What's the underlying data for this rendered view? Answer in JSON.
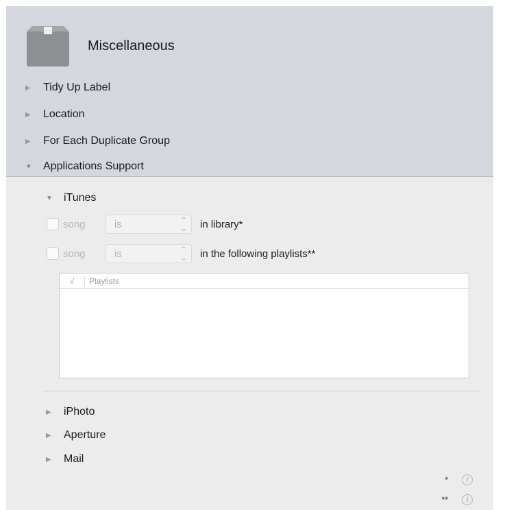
{
  "header": {
    "title": "Miscellaneous",
    "icon": "box-icon"
  },
  "sections": [
    {
      "label": "Tidy Up Label",
      "expanded": false
    },
    {
      "label": "Location",
      "expanded": false
    },
    {
      "label": "For Each Duplicate Group",
      "expanded": false
    },
    {
      "label": "Applications Support",
      "expanded": true
    }
  ],
  "itunes": {
    "label": "iTunes",
    "conditions": [
      {
        "subject": "song",
        "operator": "is",
        "label": "in library*"
      },
      {
        "subject": "song",
        "operator": "is",
        "label": "in the following playlists**"
      }
    ],
    "table": {
      "check_header": "√",
      "column_header": "Playlists"
    }
  },
  "subsections": [
    {
      "label": "iPhoto"
    },
    {
      "label": "Aperture"
    },
    {
      "label": "Mail"
    }
  ],
  "footnotes": [
    {
      "mark": "*",
      "icon": "info-icon"
    },
    {
      "mark": "**",
      "icon": "info-icon"
    }
  ],
  "colors": {
    "header_bg": "#d4d7de",
    "panel_bg": "#ececec"
  }
}
